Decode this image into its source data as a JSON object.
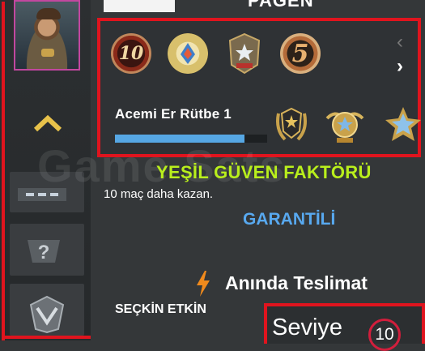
{
  "header": {
    "title": "PAGEN"
  },
  "medals": {
    "items": [
      {
        "name": "10-year-coin",
        "label": "10"
      },
      {
        "name": "blue-compass-coin"
      },
      {
        "name": "star-shield-medal"
      },
      {
        "name": "5-year-coin",
        "label": "5"
      }
    ],
    "nav_prev": "‹",
    "nav_next": "›"
  },
  "rank": {
    "label": "Acemi Er Rütbe 1",
    "progress": 0.85
  },
  "promo": {
    "trust": "YEŞİL GÜVEN FAKTÖRÜ",
    "wins_needed": "10 maç daha kazan.",
    "guarantee": "GARANTİLİ",
    "delivery": "Anında Teslimat",
    "elite": "SEÇKİN ETKİN",
    "watermark": "Game Sats"
  },
  "level": {
    "label": "Seviye",
    "value": "10"
  },
  "colors": {
    "frame": "#e0141e",
    "trust": "#b9ef1c",
    "guarantee": "#58a9f0",
    "progress": "#56a7e4"
  }
}
